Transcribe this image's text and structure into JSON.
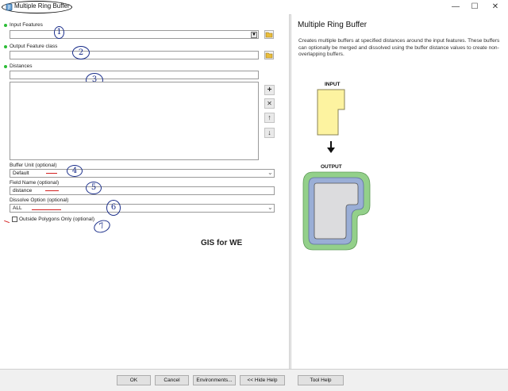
{
  "window": {
    "title": "Multiple Ring Buffer",
    "minimize_glyph": "—",
    "maximize_glyph": "☐",
    "close_glyph": "✕"
  },
  "form": {
    "input_features_label": "Input Features",
    "input_features_value": "",
    "output_feature_class_label": "Output Feature class",
    "output_feature_class_value": "",
    "distances_label": "Distances",
    "distances_value": "",
    "distances_list": [],
    "buffer_unit_label": "Buffer Unit (optional)",
    "buffer_unit_value": "Default",
    "field_name_label": "Field Name (optional)",
    "field_name_value": "distance",
    "dissolve_option_label": "Dissolve Option (optional)",
    "dissolve_option_value": "ALL",
    "outside_polygons_label": "Outside Polygons Only (optional)",
    "outside_polygons_checked": false
  },
  "list_buttons": {
    "add_glyph": "+",
    "remove_glyph": "✕",
    "up_glyph": "↑",
    "down_glyph": "↓"
  },
  "annotations": {
    "numbers": [
      "1",
      "2",
      "3",
      "4",
      "5",
      "6",
      "7"
    ],
    "color_red": "#d42020",
    "color_blue": "#1a2e8a"
  },
  "watermark": "GIS for WE",
  "help": {
    "title": "Multiple Ring Buffer",
    "body": "Creates multiple buffers at specified distances around the input features. These buffers can optionally be merged and dissolved using the buffer distance values to create non-overlapping buffers.",
    "diagram_input_label": "INPUT",
    "diagram_output_label": "OUTPUT"
  },
  "buttons": {
    "ok": "OK",
    "cancel": "Cancel",
    "environments": "Environments...",
    "hide_help": "<< Hide Help",
    "tool_help": "Tool Help"
  },
  "colors": {
    "input_fill": "#fdf3a0",
    "output_outer_ring": "#93d08a",
    "output_middle_ring": "#9aaed6",
    "output_core": "#dcdcde",
    "required_dot": "#2bbd36"
  }
}
